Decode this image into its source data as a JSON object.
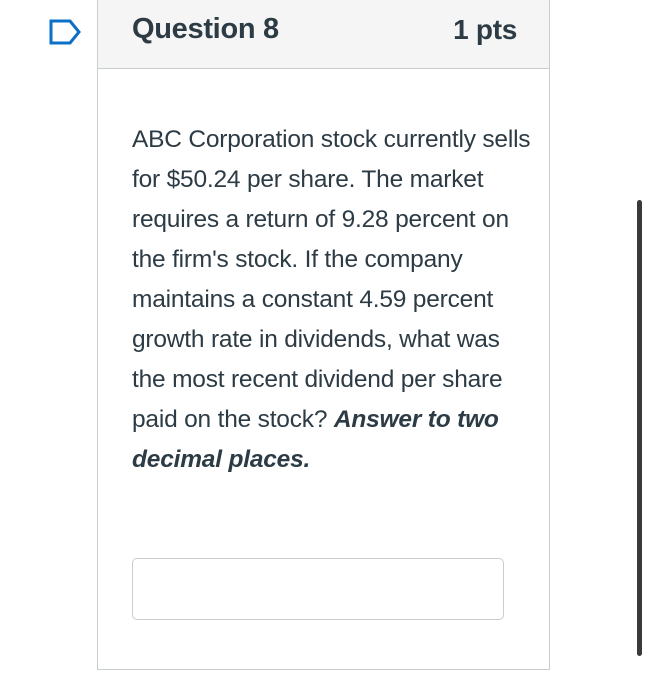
{
  "question": {
    "title": "Question 8",
    "points": "1 pts",
    "body_text": "ABC Corporation stock currently sells for $50.24 per share. The market requires a return of 9.28 percent on the firm's stock. If the company maintains a constant 4.59 percent growth rate in dividends, what was the most recent dividend per share paid on the stock?",
    "instruction": "Answer to two decimal places.",
    "answer_value": "",
    "answer_placeholder": ""
  },
  "icons": {
    "flag": "flag-question-icon"
  },
  "colors": {
    "text": "#2d3b45",
    "flag": "#0b6fc7",
    "border": "#c7cdd1",
    "header_bg": "#f5f5f5"
  }
}
